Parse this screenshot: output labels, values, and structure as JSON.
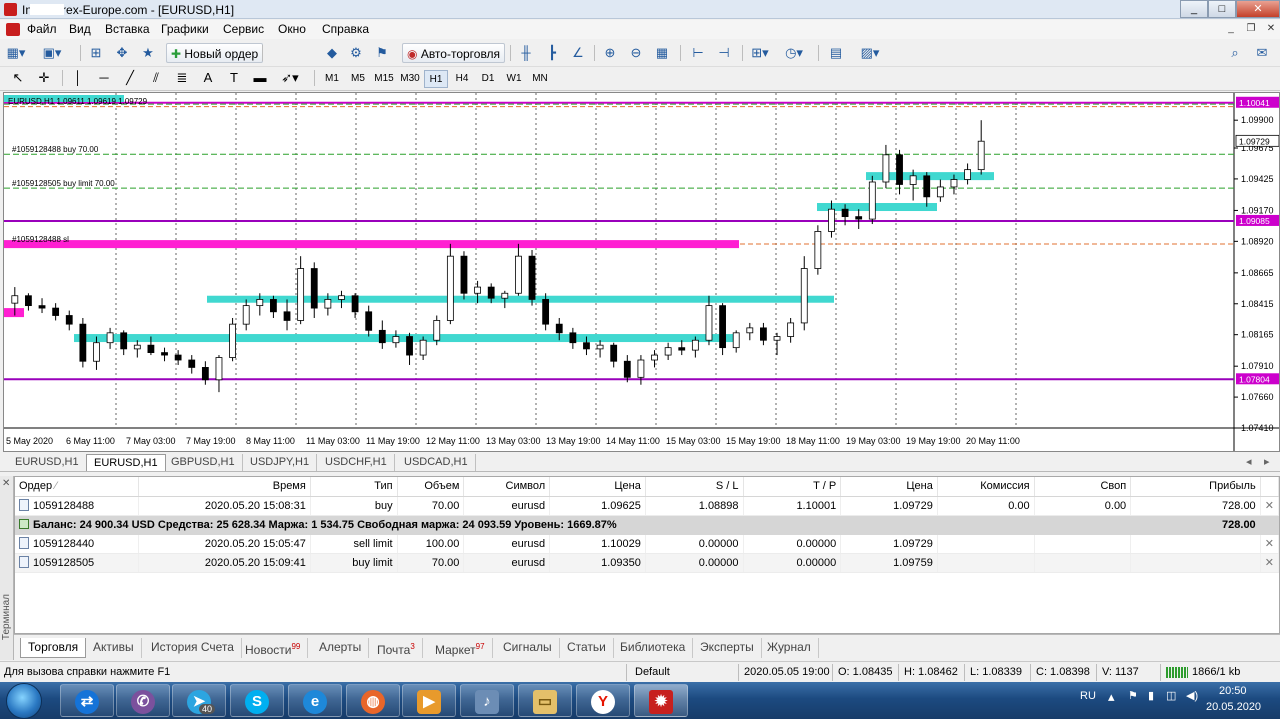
{
  "window": {
    "title": "InstaForex-Europe.com - [EURUSD,H1]",
    "min": "_",
    "max": "□",
    "close": "✕"
  },
  "menu": [
    "Файл",
    "Вид",
    "Вставка",
    "Графики",
    "Сервис",
    "Окно",
    "Справка"
  ],
  "mdi": {
    "min": "_",
    "restore": "❐",
    "close": "✕"
  },
  "toolbar1": {
    "new_order": "Новый ордер",
    "auto_trading": "Авто-торговля"
  },
  "toolbar2": {
    "text_tool": "A",
    "timeframes": [
      "M1",
      "M5",
      "M15",
      "M30",
      "H1",
      "H4",
      "D1",
      "W1",
      "MN"
    ],
    "selected_timeframe": "H1"
  },
  "chart_data": {
    "type": "candlestick",
    "symbol_header": "EURUSD,H1  1.09611 1.09619 1.09729",
    "price_ticks": [
      "1.09900",
      "1.09675",
      "1.09425",
      "1.09170",
      "1.08920",
      "1.08665",
      "1.08415",
      "1.08165",
      "1.07910",
      "1.07660",
      "1.07410"
    ],
    "price_tags": [
      {
        "value": "1.10041",
        "color": "#cc00cc"
      },
      {
        "value": "1.09729",
        "color": "#ffffff"
      },
      {
        "value": "1.09085",
        "color": "#cc00cc"
      },
      {
        "value": "1.07804",
        "color": "#cc00cc"
      }
    ],
    "time_ticks": [
      "5 May 2020",
      "6 May 11:00",
      "7 May 03:00",
      "7 May 19:00",
      "8 May 11:00",
      "11 May 03:00",
      "11 May 19:00",
      "12 May 11:00",
      "13 May 03:00",
      "13 May 19:00",
      "14 May 11:00",
      "15 May 03:00",
      "15 May 19:00",
      "18 May 11:00",
      "19 May 03:00",
      "19 May 19:00",
      "20 May 11:00"
    ],
    "order_labels": [
      {
        "text": "#1059128488 buy 70.00",
        "price": 1.09625
      },
      {
        "text": "#1059128505 buy limit 70.00",
        "price": 1.0935
      },
      {
        "text": "#1059128488 sl",
        "price": 1.08898
      }
    ],
    "y_range": [
      1.0741,
      1.1012
    ],
    "candles": [
      [
        1.0842,
        1.0855,
        1.0832,
        1.0848
      ],
      [
        1.0848,
        1.085,
        1.0836,
        1.084
      ],
      [
        1.084,
        1.0846,
        1.0834,
        1.0838
      ],
      [
        1.0838,
        1.0842,
        1.0828,
        1.0832
      ],
      [
        1.0832,
        1.0836,
        1.082,
        1.0825
      ],
      [
        1.0825,
        1.083,
        1.079,
        1.0795
      ],
      [
        1.0795,
        1.0815,
        1.0788,
        1.081
      ],
      [
        1.081,
        1.0822,
        1.0805,
        1.0818
      ],
      [
        1.0818,
        1.082,
        1.08,
        1.0805
      ],
      [
        1.0805,
        1.0812,
        1.0798,
        1.0808
      ],
      [
        1.0808,
        1.0815,
        1.08,
        1.0802
      ],
      [
        1.0802,
        1.0806,
        1.0795,
        1.08
      ],
      [
        1.08,
        1.0804,
        1.0792,
        1.0796
      ],
      [
        1.0796,
        1.08,
        1.0785,
        1.079
      ],
      [
        1.079,
        1.0795,
        1.0776,
        1.078
      ],
      [
        1.078,
        1.08,
        1.077,
        1.0798
      ],
      [
        1.0798,
        1.083,
        1.0795,
        1.0825
      ],
      [
        1.0825,
        1.0845,
        1.082,
        1.084
      ],
      [
        1.084,
        1.085,
        1.0832,
        1.0845
      ],
      [
        1.0845,
        1.0848,
        1.083,
        1.0835
      ],
      [
        1.0835,
        1.0845,
        1.082,
        1.0828
      ],
      [
        1.0828,
        1.088,
        1.0825,
        1.087
      ],
      [
        1.087,
        1.0875,
        1.083,
        1.0838
      ],
      [
        1.0838,
        1.085,
        1.0832,
        1.0845
      ],
      [
        1.0845,
        1.0852,
        1.0838,
        1.0848
      ],
      [
        1.0848,
        1.085,
        1.083,
        1.0835
      ],
      [
        1.0835,
        1.084,
        1.0815,
        1.082
      ],
      [
        1.082,
        1.0828,
        1.0805,
        1.081
      ],
      [
        1.081,
        1.082,
        1.0806,
        1.0815
      ],
      [
        1.0815,
        1.0818,
        1.0792,
        1.08
      ],
      [
        1.08,
        1.0815,
        1.0796,
        1.0812
      ],
      [
        1.0812,
        1.0832,
        1.0808,
        1.0828
      ],
      [
        1.0828,
        1.089,
        1.0825,
        1.088
      ],
      [
        1.088,
        1.0884,
        1.0845,
        1.085
      ],
      [
        1.085,
        1.086,
        1.0842,
        1.0855
      ],
      [
        1.0855,
        1.0858,
        1.0842,
        1.0846
      ],
      [
        1.0846,
        1.0852,
        1.0838,
        1.085
      ],
      [
        1.085,
        1.089,
        1.0848,
        1.088
      ],
      [
        1.088,
        1.0885,
        1.084,
        1.0845
      ],
      [
        1.0845,
        1.085,
        1.082,
        1.0825
      ],
      [
        1.0825,
        1.083,
        1.0812,
        1.0818
      ],
      [
        1.0818,
        1.0822,
        1.0805,
        1.081
      ],
      [
        1.081,
        1.0815,
        1.08,
        1.0805
      ],
      [
        1.0805,
        1.0812,
        1.0798,
        1.0808
      ],
      [
        1.0808,
        1.081,
        1.079,
        1.0795
      ],
      [
        1.0795,
        1.08,
        1.0778,
        1.0782
      ],
      [
        1.0782,
        1.08,
        1.0776,
        1.0796
      ],
      [
        1.0796,
        1.0804,
        1.079,
        1.08
      ],
      [
        1.08,
        1.081,
        1.0796,
        1.0806
      ],
      [
        1.0806,
        1.0812,
        1.08,
        1.0804
      ],
      [
        1.0804,
        1.0815,
        1.0798,
        1.0812
      ],
      [
        1.0812,
        1.0848,
        1.0808,
        1.084
      ],
      [
        1.084,
        1.0842,
        1.08,
        1.0806
      ],
      [
        1.0806,
        1.082,
        1.0802,
        1.0818
      ],
      [
        1.0818,
        1.0826,
        1.0812,
        1.0822
      ],
      [
        1.0822,
        1.0826,
        1.0808,
        1.0812
      ],
      [
        1.0812,
        1.0818,
        1.08,
        1.0815
      ],
      [
        1.0815,
        1.083,
        1.081,
        1.0826
      ],
      [
        1.0826,
        1.088,
        1.082,
        1.087
      ],
      [
        1.087,
        1.0905,
        1.0865,
        1.09
      ],
      [
        1.09,
        1.0925,
        1.0895,
        1.0918
      ],
      [
        1.0918,
        1.0922,
        1.0905,
        1.0912
      ],
      [
        1.0912,
        1.0918,
        1.0902,
        1.091
      ],
      [
        1.091,
        1.0945,
        1.0906,
        1.094
      ],
      [
        1.094,
        1.097,
        1.0935,
        1.0962
      ],
      [
        1.0962,
        1.0966,
        1.093,
        1.0938
      ],
      [
        1.0938,
        1.095,
        1.0925,
        1.0945
      ],
      [
        1.0945,
        1.0948,
        1.092,
        1.0928
      ],
      [
        1.0928,
        1.0942,
        1.0924,
        1.0936
      ],
      [
        1.0936,
        1.0946,
        1.093,
        1.0942
      ],
      [
        1.0942,
        1.0955,
        1.0938,
        1.095
      ],
      [
        1.095,
        1.099,
        1.0946,
        1.0973
      ]
    ]
  },
  "chart_tabs": [
    "EURUSD,H1",
    "EURUSD,H1",
    "GBPUSD,H1",
    "USDJPY,H1",
    "USDCHF,H1",
    "USDCAD,H1"
  ],
  "active_chart_tab": 1,
  "terminal": {
    "side_label": "Терминал",
    "columns": [
      "Ордер",
      "Время",
      "Тип",
      "Объем",
      "Символ",
      "Цена",
      "S / L",
      "T / P",
      "Цена",
      "Комиссия",
      "Своп",
      "Прибыль"
    ],
    "rows": [
      {
        "order": "1059128488",
        "time": "2020.05.20 15:08:31",
        "type": "buy",
        "volume": "70.00",
        "symbol": "eurusd",
        "price": "1.09625",
        "sl": "1.08898",
        "tp": "1.10001",
        "cur": "1.09729",
        "commission": "0.00",
        "swap": "0.00",
        "profit": "728.00"
      }
    ],
    "balance_line": "Баланс: 24 900.34 USD  Средства: 25 628.34  Маржа: 1 534.75  Свободная маржа: 24 093.59  Уровень: 1669.87%",
    "balance_profit": "728.00",
    "pending": [
      {
        "order": "1059128440",
        "time": "2020.05.20 15:05:47",
        "type": "sell limit",
        "volume": "100.00",
        "symbol": "eurusd",
        "price": "1.10029",
        "sl": "0.00000",
        "tp": "0.00000",
        "cur": "1.09729"
      },
      {
        "order": "1059128505",
        "time": "2020.05.20 15:09:41",
        "type": "buy limit",
        "volume": "70.00",
        "symbol": "eurusd",
        "price": "1.09350",
        "sl": "0.00000",
        "tp": "0.00000",
        "cur": "1.09759"
      }
    ],
    "tabs": [
      {
        "label": "Торговля",
        "badge": ""
      },
      {
        "label": "Активы",
        "badge": ""
      },
      {
        "label": "История Счета",
        "badge": ""
      },
      {
        "label": "Новости",
        "badge": "99"
      },
      {
        "label": "Алерты",
        "badge": ""
      },
      {
        "label": "Почта",
        "badge": "3"
      },
      {
        "label": "Маркет",
        "badge": "97"
      },
      {
        "label": "Сигналы",
        "badge": ""
      },
      {
        "label": "Статьи",
        "badge": ""
      },
      {
        "label": "Библиотека",
        "badge": ""
      },
      {
        "label": "Эксперты",
        "badge": ""
      },
      {
        "label": "Журнал",
        "badge": ""
      }
    ]
  },
  "status": {
    "help": "Для вызова справки нажмите F1",
    "profile": "Default",
    "datetime": "2020.05.05 19:00",
    "open": "O: 1.08435",
    "high": "H: 1.08462",
    "low": "L: 1.08339",
    "close": "C: 1.08398",
    "volume": "V: 1137",
    "traffic": "1866/1 kb"
  },
  "taskbar": {
    "telegram_badge": "40",
    "lang": "RU",
    "time": "20:50",
    "date": "20.05.2020"
  }
}
